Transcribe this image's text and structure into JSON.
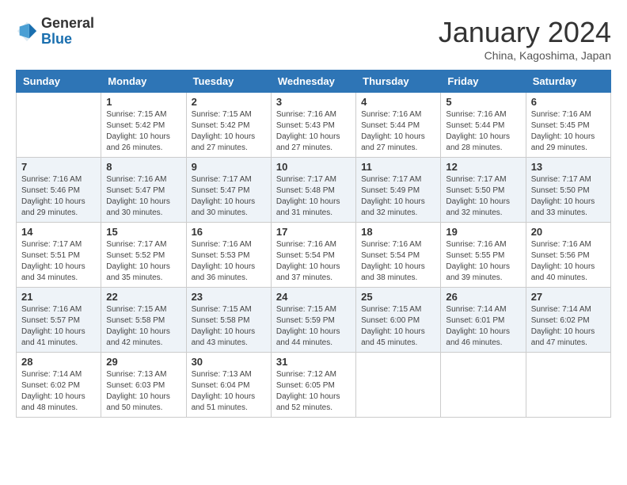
{
  "header": {
    "logo_general": "General",
    "logo_blue": "Blue",
    "month_title": "January 2024",
    "subtitle": "China, Kagoshima, Japan"
  },
  "columns": [
    "Sunday",
    "Monday",
    "Tuesday",
    "Wednesday",
    "Thursday",
    "Friday",
    "Saturday"
  ],
  "weeks": [
    [
      {
        "day": "",
        "sunrise": "",
        "sunset": "",
        "daylight": ""
      },
      {
        "day": "1",
        "sunrise": "Sunrise: 7:15 AM",
        "sunset": "Sunset: 5:42 PM",
        "daylight": "Daylight: 10 hours and 26 minutes."
      },
      {
        "day": "2",
        "sunrise": "Sunrise: 7:15 AM",
        "sunset": "Sunset: 5:42 PM",
        "daylight": "Daylight: 10 hours and 27 minutes."
      },
      {
        "day": "3",
        "sunrise": "Sunrise: 7:16 AM",
        "sunset": "Sunset: 5:43 PM",
        "daylight": "Daylight: 10 hours and 27 minutes."
      },
      {
        "day": "4",
        "sunrise": "Sunrise: 7:16 AM",
        "sunset": "Sunset: 5:44 PM",
        "daylight": "Daylight: 10 hours and 27 minutes."
      },
      {
        "day": "5",
        "sunrise": "Sunrise: 7:16 AM",
        "sunset": "Sunset: 5:44 PM",
        "daylight": "Daylight: 10 hours and 28 minutes."
      },
      {
        "day": "6",
        "sunrise": "Sunrise: 7:16 AM",
        "sunset": "Sunset: 5:45 PM",
        "daylight": "Daylight: 10 hours and 29 minutes."
      }
    ],
    [
      {
        "day": "7",
        "sunrise": "Sunrise: 7:16 AM",
        "sunset": "Sunset: 5:46 PM",
        "daylight": "Daylight: 10 hours and 29 minutes."
      },
      {
        "day": "8",
        "sunrise": "Sunrise: 7:16 AM",
        "sunset": "Sunset: 5:47 PM",
        "daylight": "Daylight: 10 hours and 30 minutes."
      },
      {
        "day": "9",
        "sunrise": "Sunrise: 7:17 AM",
        "sunset": "Sunset: 5:47 PM",
        "daylight": "Daylight: 10 hours and 30 minutes."
      },
      {
        "day": "10",
        "sunrise": "Sunrise: 7:17 AM",
        "sunset": "Sunset: 5:48 PM",
        "daylight": "Daylight: 10 hours and 31 minutes."
      },
      {
        "day": "11",
        "sunrise": "Sunrise: 7:17 AM",
        "sunset": "Sunset: 5:49 PM",
        "daylight": "Daylight: 10 hours and 32 minutes."
      },
      {
        "day": "12",
        "sunrise": "Sunrise: 7:17 AM",
        "sunset": "Sunset: 5:50 PM",
        "daylight": "Daylight: 10 hours and 32 minutes."
      },
      {
        "day": "13",
        "sunrise": "Sunrise: 7:17 AM",
        "sunset": "Sunset: 5:50 PM",
        "daylight": "Daylight: 10 hours and 33 minutes."
      }
    ],
    [
      {
        "day": "14",
        "sunrise": "Sunrise: 7:17 AM",
        "sunset": "Sunset: 5:51 PM",
        "daylight": "Daylight: 10 hours and 34 minutes."
      },
      {
        "day": "15",
        "sunrise": "Sunrise: 7:17 AM",
        "sunset": "Sunset: 5:52 PM",
        "daylight": "Daylight: 10 hours and 35 minutes."
      },
      {
        "day": "16",
        "sunrise": "Sunrise: 7:16 AM",
        "sunset": "Sunset: 5:53 PM",
        "daylight": "Daylight: 10 hours and 36 minutes."
      },
      {
        "day": "17",
        "sunrise": "Sunrise: 7:16 AM",
        "sunset": "Sunset: 5:54 PM",
        "daylight": "Daylight: 10 hours and 37 minutes."
      },
      {
        "day": "18",
        "sunrise": "Sunrise: 7:16 AM",
        "sunset": "Sunset: 5:54 PM",
        "daylight": "Daylight: 10 hours and 38 minutes."
      },
      {
        "day": "19",
        "sunrise": "Sunrise: 7:16 AM",
        "sunset": "Sunset: 5:55 PM",
        "daylight": "Daylight: 10 hours and 39 minutes."
      },
      {
        "day": "20",
        "sunrise": "Sunrise: 7:16 AM",
        "sunset": "Sunset: 5:56 PM",
        "daylight": "Daylight: 10 hours and 40 minutes."
      }
    ],
    [
      {
        "day": "21",
        "sunrise": "Sunrise: 7:16 AM",
        "sunset": "Sunset: 5:57 PM",
        "daylight": "Daylight: 10 hours and 41 minutes."
      },
      {
        "day": "22",
        "sunrise": "Sunrise: 7:15 AM",
        "sunset": "Sunset: 5:58 PM",
        "daylight": "Daylight: 10 hours and 42 minutes."
      },
      {
        "day": "23",
        "sunrise": "Sunrise: 7:15 AM",
        "sunset": "Sunset: 5:58 PM",
        "daylight": "Daylight: 10 hours and 43 minutes."
      },
      {
        "day": "24",
        "sunrise": "Sunrise: 7:15 AM",
        "sunset": "Sunset: 5:59 PM",
        "daylight": "Daylight: 10 hours and 44 minutes."
      },
      {
        "day": "25",
        "sunrise": "Sunrise: 7:15 AM",
        "sunset": "Sunset: 6:00 PM",
        "daylight": "Daylight: 10 hours and 45 minutes."
      },
      {
        "day": "26",
        "sunrise": "Sunrise: 7:14 AM",
        "sunset": "Sunset: 6:01 PM",
        "daylight": "Daylight: 10 hours and 46 minutes."
      },
      {
        "day": "27",
        "sunrise": "Sunrise: 7:14 AM",
        "sunset": "Sunset: 6:02 PM",
        "daylight": "Daylight: 10 hours and 47 minutes."
      }
    ],
    [
      {
        "day": "28",
        "sunrise": "Sunrise: 7:14 AM",
        "sunset": "Sunset: 6:02 PM",
        "daylight": "Daylight: 10 hours and 48 minutes."
      },
      {
        "day": "29",
        "sunrise": "Sunrise: 7:13 AM",
        "sunset": "Sunset: 6:03 PM",
        "daylight": "Daylight: 10 hours and 50 minutes."
      },
      {
        "day": "30",
        "sunrise": "Sunrise: 7:13 AM",
        "sunset": "Sunset: 6:04 PM",
        "daylight": "Daylight: 10 hours and 51 minutes."
      },
      {
        "day": "31",
        "sunrise": "Sunrise: 7:12 AM",
        "sunset": "Sunset: 6:05 PM",
        "daylight": "Daylight: 10 hours and 52 minutes."
      },
      {
        "day": "",
        "sunrise": "",
        "sunset": "",
        "daylight": ""
      },
      {
        "day": "",
        "sunrise": "",
        "sunset": "",
        "daylight": ""
      },
      {
        "day": "",
        "sunrise": "",
        "sunset": "",
        "daylight": ""
      }
    ]
  ]
}
